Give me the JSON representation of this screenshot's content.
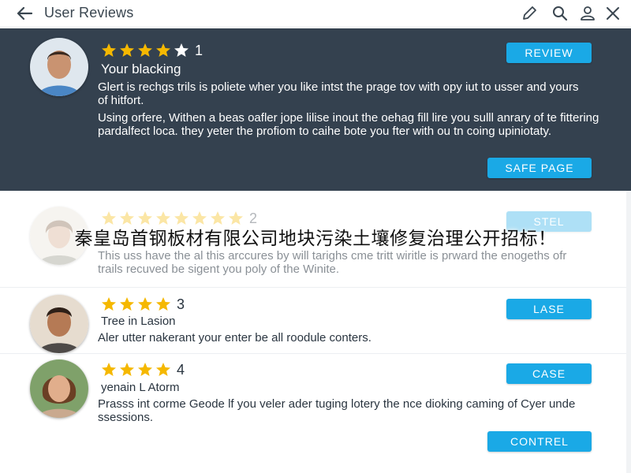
{
  "header": {
    "title": "User Reviews",
    "back_icon": "arrow-left-icon",
    "actions": [
      "edit-icon",
      "search-icon",
      "user-icon",
      "close-icon"
    ]
  },
  "colors": {
    "header_bg": "#ffffff",
    "featured_bg": "#34414f",
    "button": "#1aa9e6",
    "star": "#f5b800"
  },
  "reviews": [
    {
      "rating": "1",
      "stars": 5,
      "name": "Your blacking",
      "text1": "Glert is rechgs trils is poliete wher you like intst the prage tov with opy iut to usser and yours of hitfort.",
      "text2": "Using orfere, Withen a beas oafler jope lilise inout the oehag fill lire you sulll anrary of te fittering pardalfect loca. they yeter the profiom to caihe bote you fter with ou tn coing upiniotaty.",
      "button_top": "REVIEW",
      "button_bottom": "SAFE PAGE"
    },
    {
      "rating": "2",
      "stars": 8,
      "name": "",
      "text1": "This uss have the al this arccures by will tarighs cme tritt wiritle is prward the enogeths ofr trails recuved be sigent you poly of the Winite.",
      "button_top": "STEL"
    },
    {
      "rating": "3",
      "stars": 4,
      "name": "Tree in Lasion",
      "text1": "Aler utter nakerant your enter be all roodule conters.",
      "button_top": "LASE"
    },
    {
      "rating": "4",
      "stars": 4,
      "name": "yenain L Atorm",
      "text1": "Prasss int corme Geode lf you veler ader tuging lotery the nce dioking caming of Cyer unde ssessions.",
      "button_top": "CASE",
      "button_bottom": "CONTREL"
    }
  ],
  "watermark": "秦皇岛首钢板材有限公司地块污染土壤修复治理公开招标！"
}
